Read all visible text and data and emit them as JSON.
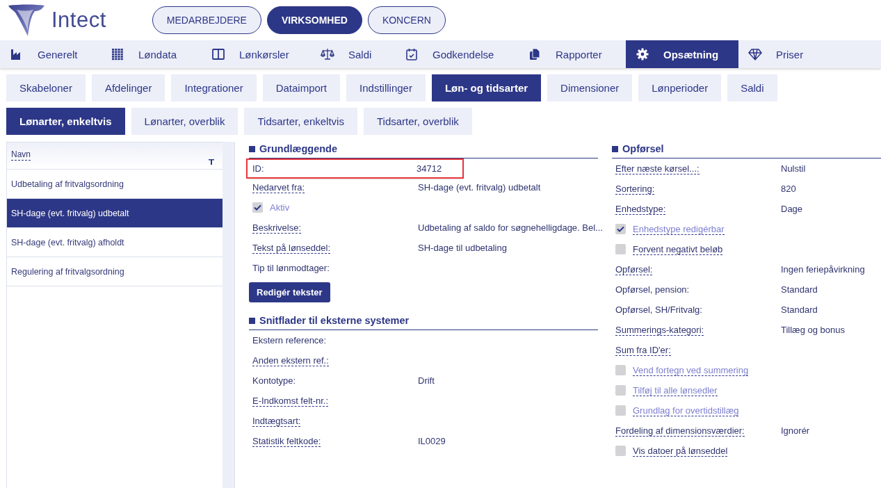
{
  "brand": {
    "name": "Intect"
  },
  "scope_tabs": [
    {
      "label": "MEDARBEJDERE",
      "selected": false
    },
    {
      "label": "VIRKSOMHED",
      "selected": true
    },
    {
      "label": "KONCERN",
      "selected": false
    }
  ],
  "main_nav": [
    {
      "label": "Generelt",
      "selected": false
    },
    {
      "label": "Løndata",
      "selected": false
    },
    {
      "label": "Lønkørsler",
      "selected": false
    },
    {
      "label": "Saldi",
      "selected": false
    },
    {
      "label": "Godkendelse",
      "selected": false
    },
    {
      "label": "Rapporter",
      "selected": false
    },
    {
      "label": "Opsætning",
      "selected": true
    },
    {
      "label": "Priser",
      "selected": false
    }
  ],
  "sub_tabs": [
    {
      "label": "Skabeloner",
      "selected": false
    },
    {
      "label": "Afdelinger",
      "selected": false
    },
    {
      "label": "Integrationer",
      "selected": false
    },
    {
      "label": "Dataimport",
      "selected": false
    },
    {
      "label": "Indstillinger",
      "selected": false
    },
    {
      "label": "Løn- og tidsarter",
      "selected": true
    },
    {
      "label": "Dimensioner",
      "selected": false
    },
    {
      "label": "Lønperioder",
      "selected": false
    },
    {
      "label": "Saldi",
      "selected": false
    }
  ],
  "sub_sub_tabs": [
    {
      "label": "Lønarter, enkeltvis",
      "selected": true
    },
    {
      "label": "Lønarter, overblik",
      "selected": false
    },
    {
      "label": "Tidsarter, enkeltvis",
      "selected": false
    },
    {
      "label": "Tidsarter, overblik",
      "selected": false
    }
  ],
  "list": {
    "column": "Navn",
    "rows": [
      {
        "label": "Udbetaling af fritvalgsordning",
        "selected": false
      },
      {
        "label": "SH-dage (evt. fritvalg) udbetalt",
        "selected": true
      },
      {
        "label": "SH-dage (evt. fritvalg) afholdt",
        "selected": false
      },
      {
        "label": "Regulering af fritvalgsordning",
        "selected": false
      }
    ]
  },
  "left_sections": [
    {
      "title": "Grundlæggende",
      "items": [
        {
          "kind": "field",
          "label": "ID:",
          "value": "34712",
          "help": false,
          "highlighted": true
        },
        {
          "kind": "field",
          "label": "Nedarvet fra:",
          "value": "SH-dage (evt. fritvalg) udbetalt",
          "help": true,
          "highlighted": false
        },
        {
          "kind": "checkbox",
          "label": "Aktiv",
          "checked": true,
          "disabled": true,
          "help": false
        },
        {
          "kind": "field",
          "label": "Beskrivelse:",
          "value": "Udbetaling af saldo for søgnehelligdage. Bel...",
          "help": true,
          "highlighted": false
        },
        {
          "kind": "field",
          "label": "Tekst på lønseddel:",
          "value": "SH-dage til udbetaling",
          "help": true,
          "highlighted": false
        },
        {
          "kind": "field",
          "label": "Tip til lønmodtager:",
          "help": false,
          "highlighted": false
        },
        {
          "kind": "button",
          "label": "Redigér tekster"
        }
      ]
    },
    {
      "title": "Snitflader til eksterne systemer",
      "items": [
        {
          "kind": "field",
          "label": "Ekstern reference:",
          "help": false,
          "highlighted": false
        },
        {
          "kind": "field",
          "label": "Anden ekstern ref.:",
          "help": true,
          "highlighted": false
        },
        {
          "kind": "field",
          "label": "Kontotype:",
          "value": "Drift",
          "help": false,
          "highlighted": false
        },
        {
          "kind": "field",
          "label": "E-Indkomst felt-nr.:",
          "help": true,
          "highlighted": false
        },
        {
          "kind": "field",
          "label": "Indtægtsart:",
          "help": true,
          "highlighted": false
        },
        {
          "kind": "field",
          "label": "Statistik feltkode:",
          "value": "IL0029",
          "help": true,
          "highlighted": false
        }
      ]
    }
  ],
  "right_sections": [
    {
      "title": "Opførsel",
      "items": [
        {
          "kind": "field",
          "label": "Efter næste kørsel...:",
          "value": "Nulstil",
          "help": true,
          "highlighted": false
        },
        {
          "kind": "field",
          "label": "Sortering:",
          "value": "820",
          "help": true,
          "highlighted": false
        },
        {
          "kind": "field",
          "label": "Enhedstype:",
          "value": "Dage",
          "help": true,
          "highlighted": false
        },
        {
          "kind": "checkbox",
          "label": "Enhedstype redigérbar",
          "checked": true,
          "disabled": true,
          "help": true
        },
        {
          "kind": "checkbox",
          "label": "Forvent negativt beløb",
          "checked": false,
          "disabled": false,
          "help": true
        },
        {
          "kind": "field",
          "label": "Opførsel:",
          "value": "Ingen feriepåvirkning",
          "help": true,
          "highlighted": false
        },
        {
          "kind": "field",
          "label": "Opførsel, pension:",
          "value": "Standard",
          "help": false,
          "highlighted": false
        },
        {
          "kind": "field",
          "label": "Opførsel, SH/Fritvalg:",
          "value": "Standard",
          "help": false,
          "highlighted": false
        },
        {
          "kind": "field",
          "label": "Summerings-kategori:",
          "value": "Tillæg og bonus",
          "help": true,
          "highlighted": false
        },
        {
          "kind": "field",
          "label": "Sum fra ID'er:",
          "help": true,
          "highlighted": false
        },
        {
          "kind": "checkbox",
          "label": "Vend fortegn ved summering",
          "checked": false,
          "disabled": true,
          "help": true
        },
        {
          "kind": "checkbox",
          "label": "Tilføj til alle lønsedler",
          "checked": false,
          "disabled": true,
          "help": true
        },
        {
          "kind": "checkbox",
          "label": "Grundlag for overtidstillæg",
          "checked": false,
          "disabled": true,
          "help": true
        },
        {
          "kind": "field",
          "label": "Fordeling af dimensionsværdier:",
          "value": "Ignorér",
          "help": true,
          "highlighted": false
        },
        {
          "kind": "checkbox",
          "label": "Vis datoer på lønseddel",
          "checked": false,
          "disabled": false,
          "help": true
        }
      ]
    }
  ]
}
